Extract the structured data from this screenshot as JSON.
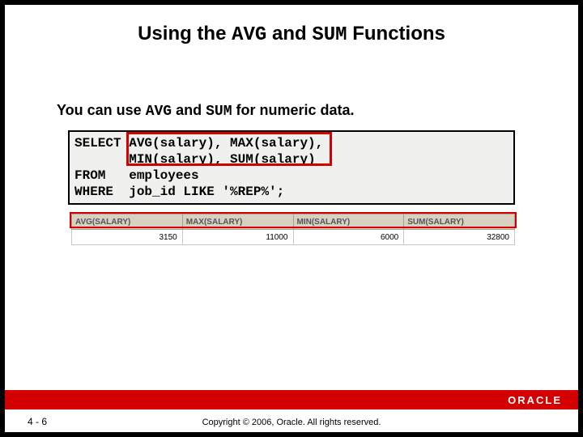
{
  "title": {
    "pre": "Using the ",
    "fn1": "AVG",
    "mid": " and ",
    "fn2": "SUM",
    "post": " Functions"
  },
  "subtitle": {
    "pre": "You can use ",
    "fn1": "AVG",
    "mid": " and ",
    "fn2": "SUM",
    "post": " for numeric data."
  },
  "code": {
    "line1": "SELECT AVG(salary), MAX(salary),",
    "line2": "       MIN(salary), SUM(salary)",
    "line3": "FROM   employees",
    "line4": "WHERE  job_id LIKE '%REP%';"
  },
  "result": {
    "headers": [
      "AVG(SALARY)",
      "MAX(SALARY)",
      "MIN(SALARY)",
      "SUM(SALARY)"
    ],
    "row": [
      "3150",
      "11000",
      "6000",
      "32800"
    ]
  },
  "footer": {
    "page": "4 - 6",
    "copyright": "Copyright © 2006, Oracle. All rights reserved.",
    "logo": "ORACLE"
  }
}
